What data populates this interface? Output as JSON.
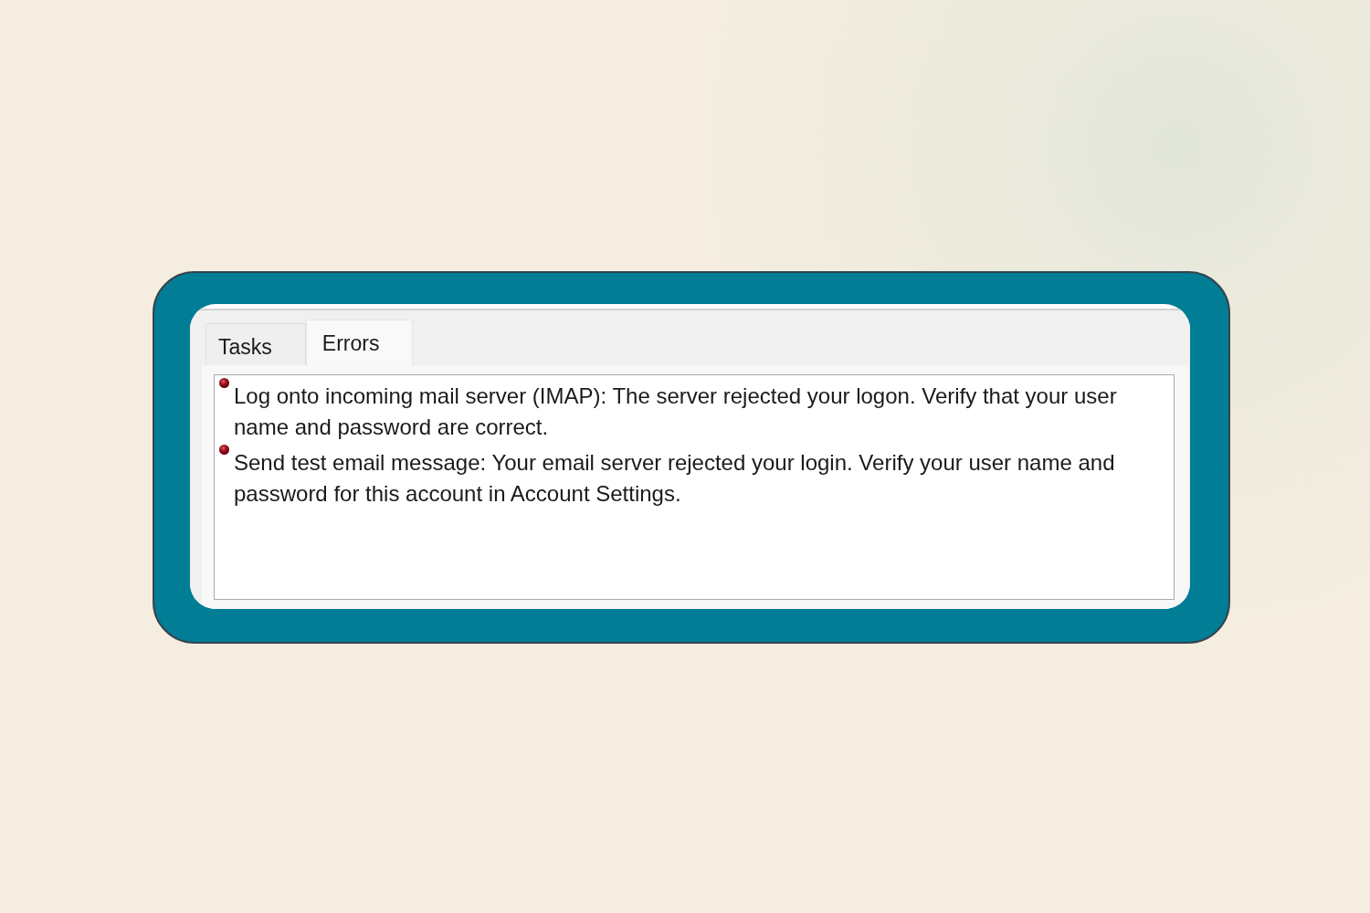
{
  "tabs": [
    {
      "label": "Tasks",
      "selected": false
    },
    {
      "label": "Errors",
      "selected": true
    }
  ],
  "errors": [
    {
      "message": "Log onto incoming mail server (IMAP): The server rejected your logon. Verify that your user name and password are correct."
    },
    {
      "message": "Send test email message: Your email server rejected your login. Verify your user name and password for this account in Account Settings."
    }
  ]
}
